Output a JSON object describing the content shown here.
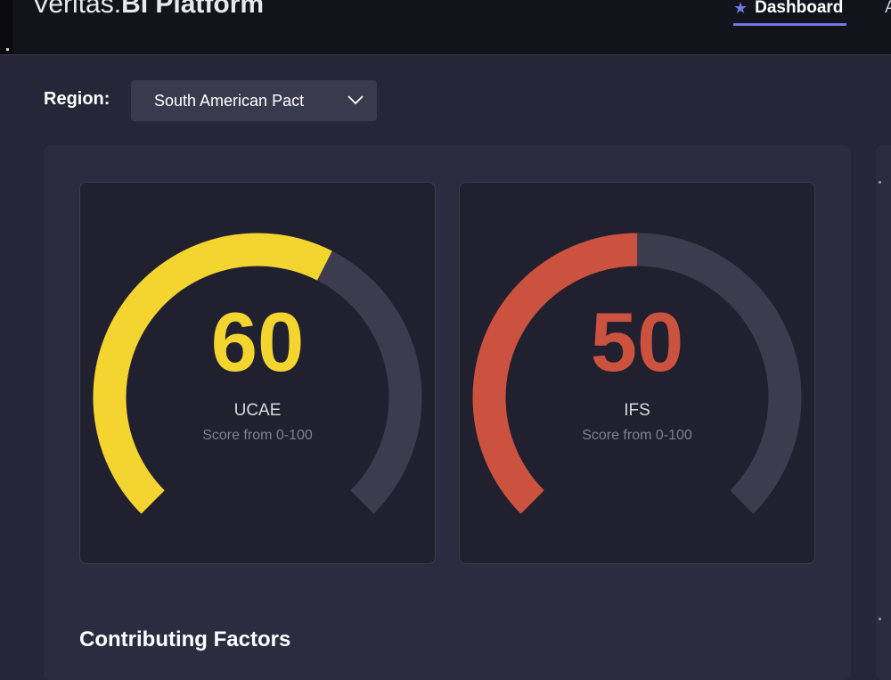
{
  "header": {
    "brand_light": "Veritas.",
    "brand_bold": "BI Platform",
    "nav": {
      "active_tab": "Dashboard",
      "active_icon": "star-icon",
      "next_tab_partial": "A"
    }
  },
  "filters": {
    "region_label": "Region:",
    "region_value": "South American Pact"
  },
  "gauges": [
    {
      "name": "UCAE",
      "value": "60",
      "subtitle": "Score from 0-100",
      "score": 60,
      "color": "#f4d530",
      "track_color": "#3c3c4e"
    },
    {
      "name": "IFS",
      "value": "50",
      "subtitle": "Score from 0-100",
      "score": 50,
      "color": "#cc5240",
      "track_color": "#3c3c4e"
    }
  ],
  "sections": {
    "factors_title": "Contributing Factors"
  },
  "colors": {
    "accent": "#6f78e6",
    "background": "#262638",
    "panel": "#2c2c41",
    "card": "#20202f"
  }
}
